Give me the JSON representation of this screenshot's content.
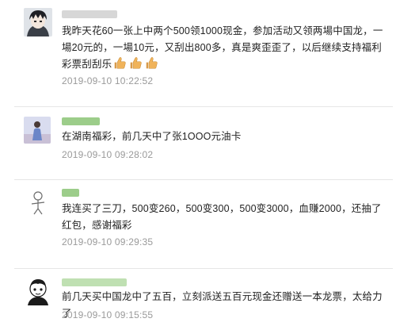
{
  "colors": {
    "text": "#222222",
    "timestamp": "#9a9a9a",
    "divider": "#e6e6e6",
    "nickname_green": "#9ccd8a"
  },
  "comments": [
    {
      "avatar": "anime-boy-avatar",
      "text": "我昨天花60一张上中两个500领1000现金，参加活动又领两場中国龙，一場20元的，一場10元，又刮出800多，真是爽歪歪了，以后继续支持福利彩票刮刮乐",
      "emoji": [
        "thumbs-up",
        "thumbs-up",
        "thumbs-up"
      ],
      "time": "2019-09-10 10:22:52"
    },
    {
      "avatar": "girl-photo-avatar",
      "text": "在湖南福彩，前几天中了张1OOO元油卡",
      "time": "2019-09-10 09:28:02"
    },
    {
      "avatar": "sketch-figure-avatar",
      "text": "我连买了三刀，500变260，500变300，500变3000，血赚2000，还抽了红包，感谢福彩",
      "time": "2019-09-10 09:29:35"
    },
    {
      "avatar": "cartoon-head-avatar",
      "text": "前几天买中国龙中了五百，立刻派送五百元现金还赠送一本龙票，太给力了",
      "time": "2019-09-10 09:15:55"
    }
  ]
}
